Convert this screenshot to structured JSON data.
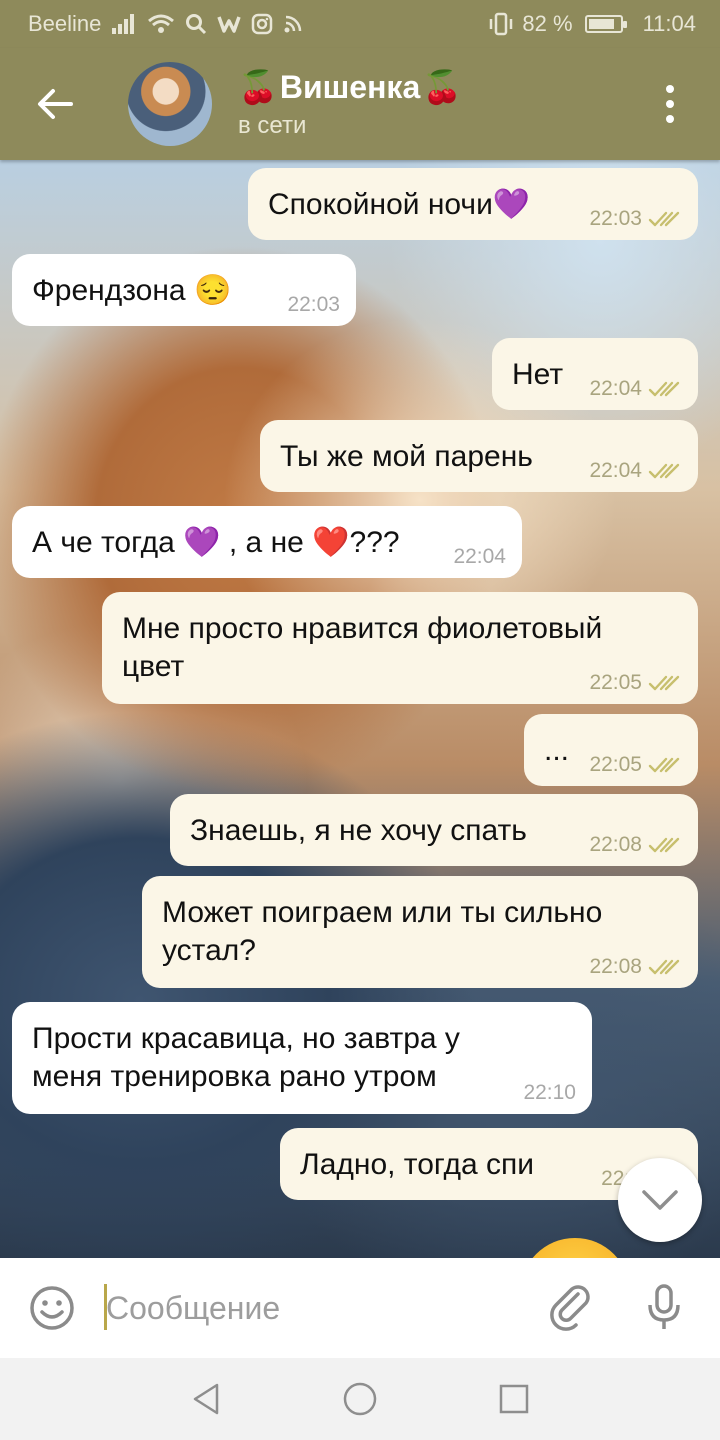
{
  "status_bar": {
    "carrier": "Beeline",
    "battery_percent": "82 %",
    "battery_level": 0.82,
    "time": "11:04",
    "icons": [
      "signal-icon",
      "wifi-icon",
      "search-icon",
      "w-app-icon",
      "instagram-icon",
      "rss-icon",
      "vibrate-icon",
      "battery-icon"
    ]
  },
  "header": {
    "back_icon": "arrow-left-icon",
    "title_emoji": "🍒",
    "title": "Вишенка",
    "status": "в сети",
    "menu_icon": "more-vertical-icon"
  },
  "messages": [
    {
      "dir": "out",
      "text": "Спокойной ночи💜",
      "time": "22:03",
      "read": true
    },
    {
      "dir": "in",
      "text": "Френдзона 😔",
      "time": "22:03"
    },
    {
      "dir": "out",
      "text": "Нет",
      "time": "22:04",
      "read": true
    },
    {
      "dir": "out",
      "text": "Ты же мой парень",
      "time": "22:04",
      "read": true
    },
    {
      "dir": "in",
      "text": "А че тогда 💜 , а не ❤️???",
      "time": "22:04"
    },
    {
      "dir": "out",
      "text": "Мне просто нравится фиолетовый\nцвет",
      "time": "22:05",
      "read": true
    },
    {
      "dir": "out",
      "text": "...",
      "time": "22:05",
      "read": true
    },
    {
      "dir": "out",
      "text": "Знаешь, я не хочу спать",
      "time": "22:08",
      "read": true
    },
    {
      "dir": "out",
      "text": "Может поиграем или ты сильно\nустал?",
      "time": "22:08",
      "read": true
    },
    {
      "dir": "in",
      "text": "Прости красавица, но завтра у\nменя тренировка рано утром",
      "time": "22:10"
    },
    {
      "dir": "out",
      "text": "Ладно, тогда спи",
      "time": "22:1",
      "read": true
    }
  ],
  "composer": {
    "placeholder": "Сообщение",
    "emoji_icon": "smiley-icon",
    "attach_icon": "paperclip-icon",
    "mic_icon": "microphone-icon"
  },
  "scroll_button_icon": "chevron-down-icon",
  "nav": {
    "back_icon": "nav-back-icon",
    "home_icon": "nav-home-icon",
    "recents_icon": "nav-recents-icon"
  },
  "colors": {
    "toolbar": "#8e8a5b",
    "outgoing_bubble": "#fbf6e7",
    "incoming_bubble": "#ffffff",
    "read_ticks": "#c7bf6e",
    "cursor": "#b9a74a"
  }
}
